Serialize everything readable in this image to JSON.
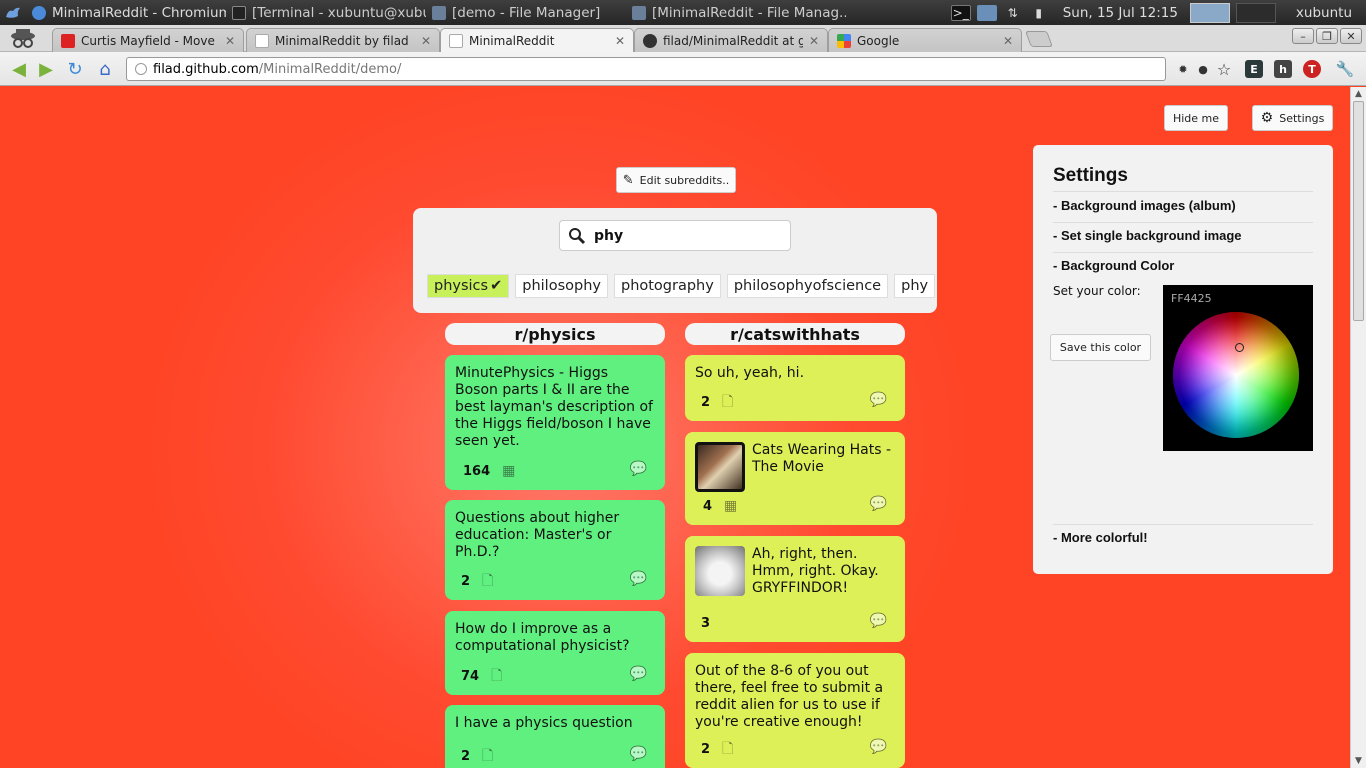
{
  "taskbar": {
    "tasks": [
      "MinimalReddit - Chromium",
      "[Terminal - xubuntu@xubu...",
      "[demo - File Manager]",
      "[MinimalReddit - File Manag..."
    ],
    "clock": "Sun, 15 Jul 12:15",
    "user": "xubuntu"
  },
  "browser": {
    "tabs": [
      {
        "label": "Curtis Mayfield - Move On U"
      },
      {
        "label": "MinimalReddit by filad"
      },
      {
        "label": "MinimalReddit"
      },
      {
        "label": "filad/MinimalReddit at gh-p"
      },
      {
        "label": "Google"
      }
    ],
    "url_host": "filad.github.com",
    "url_path": "/MinimalReddit/demo/"
  },
  "header": {
    "hide_label": "Hide me",
    "settings_label": "Settings",
    "edit_label": "Edit subreddits.."
  },
  "search": {
    "value": "phy",
    "suggestions": [
      {
        "label": "physics",
        "selected": true
      },
      {
        "label": "philosophy",
        "selected": false
      },
      {
        "label": "photography",
        "selected": false
      },
      {
        "label": "philosophyofscience",
        "selected": false
      },
      {
        "label": "phy",
        "selected": false
      }
    ]
  },
  "columns": [
    {
      "title": "r/physics",
      "posts": [
        {
          "title": "MinutePhysics - Higgs Boson parts I & II are the best layman's description of the Higgs field/boson I have seen yet.",
          "score": "164",
          "type": "video"
        },
        {
          "title": "Questions about higher education: Master's or Ph.D.?",
          "score": "2",
          "type": "text"
        },
        {
          "title": "How do I improve as a computational physicist?",
          "score": "74",
          "type": "text"
        },
        {
          "title": "I have a physics question",
          "score": "2",
          "type": "text"
        }
      ]
    },
    {
      "title": "r/catswithhats",
      "posts": [
        {
          "title": "So uh, yeah, hi.",
          "score": "2",
          "type": "text"
        },
        {
          "title": "Cats Wearing Hats - The Movie",
          "score": "4",
          "type": "video"
        },
        {
          "title": "Ah, right, then. Hmm, right. Okay. GRYFFINDOR!",
          "score": "3",
          "type": "image"
        },
        {
          "title": "Out of the 8-6 of you out there, feel free to submit a reddit alien for us to use if you're creative enough!",
          "score": "2",
          "type": "text"
        }
      ]
    }
  ],
  "settings": {
    "title": "Settings",
    "items": [
      "- Background images (album)",
      "- Set single background image",
      "- Background Color",
      "- More colorful!"
    ],
    "color_label": "Set your color:",
    "save_label": "Save this color",
    "hex": "FF4425"
  },
  "colors": {
    "background": "#ff4425",
    "physics_card": "#60f080",
    "cats_card": "#ddf058",
    "selected_chip": "#c8f05a"
  },
  "icons": {
    "search": "magnifier-icon",
    "comment": "comment-bubble-icon",
    "text_post": "document-icon",
    "video_post": "film-icon"
  }
}
